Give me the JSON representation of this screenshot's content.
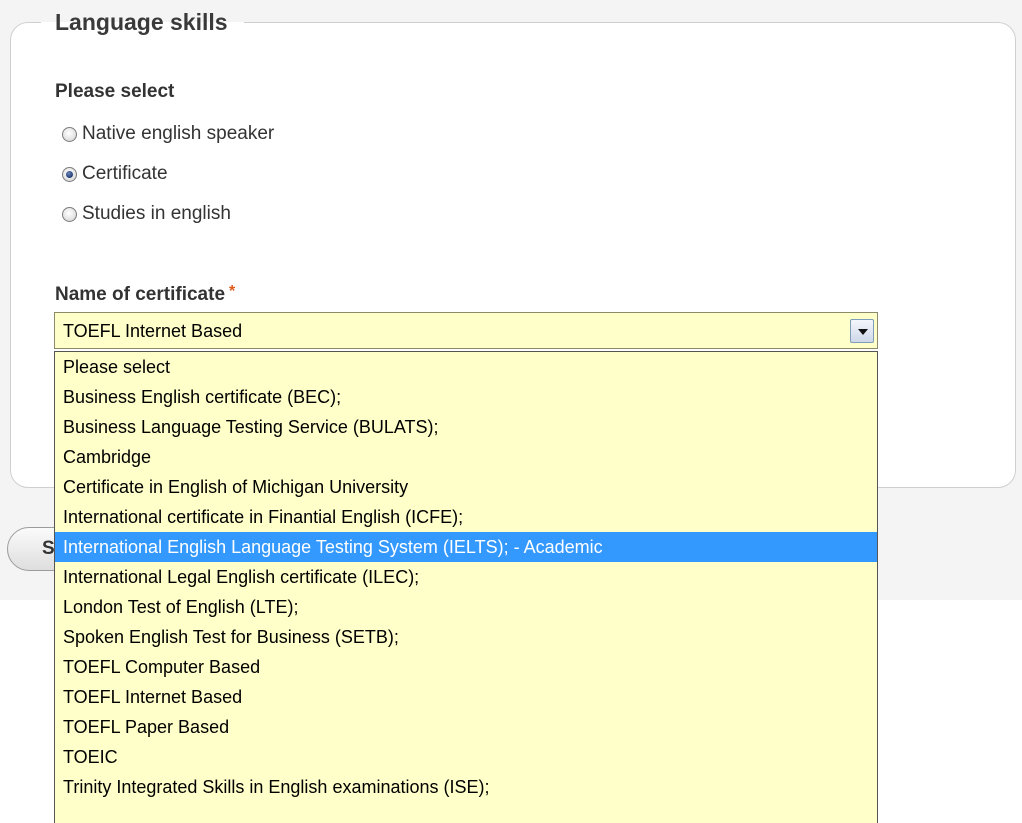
{
  "fieldset": {
    "legend": "Language skills"
  },
  "question": {
    "label": "Please select"
  },
  "radios": [
    {
      "label": "Native english speaker",
      "checked": false
    },
    {
      "label": "Certificate",
      "checked": true
    },
    {
      "label": "Studies in english",
      "checked": false
    }
  ],
  "certificate": {
    "label": "Name of certificate",
    "required_mark": "*",
    "selected_value": "TOEFL Internet Based"
  },
  "save_button": {
    "label": "S"
  },
  "dropdown": {
    "highlighted_index": 6,
    "options": [
      "Please select",
      "Business English certificate (BEC);",
      "Business Language Testing Service (BULATS);",
      "Cambridge",
      "Certificate in English of Michigan University",
      "International certificate in Finantial English (ICFE);",
      "International English Language Testing System (IELTS); - Academic",
      "International Legal English certificate (ILEC);",
      "London Test of English (LTE);",
      "Spoken English Test for Business (SETB);",
      "TOEFL Computer Based",
      "TOEFL Internet Based",
      "TOEFL Paper Based",
      "TOEIC",
      "Trinity Integrated Skills in English examinations (ISE);"
    ]
  }
}
